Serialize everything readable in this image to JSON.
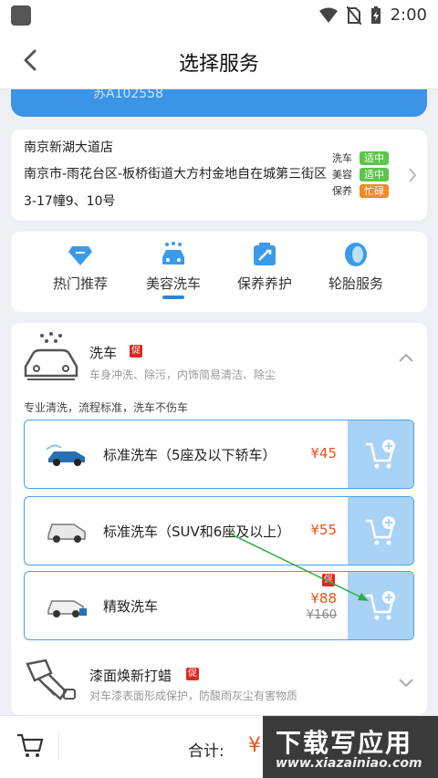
{
  "status_bar": {
    "time": "2:00"
  },
  "header": {
    "title": "选择服务"
  },
  "vehicle": {
    "plate": "苏A102558"
  },
  "store": {
    "name": "南京新湖大道店",
    "address": "南京市-雨花台区-板桥街道大方村金地自在城第三街区3-17幢9、10号",
    "statuses": [
      {
        "label": "洗车",
        "value": "适中",
        "color": "#5cc54a"
      },
      {
        "label": "美容",
        "value": "适中",
        "color": "#5cc54a"
      },
      {
        "label": "保养",
        "value": "忙碌",
        "color": "#f08a24"
      }
    ]
  },
  "categories": [
    {
      "label": "热门推荐",
      "icon": "diamond-icon"
    },
    {
      "label": "美容洗车",
      "icon": "car-wash-icon",
      "active": true
    },
    {
      "label": "保养养护",
      "icon": "maintenance-icon"
    },
    {
      "label": "轮胎服务",
      "icon": "tire-icon"
    }
  ],
  "service_wash": {
    "title": "洗车",
    "promo": "促",
    "subtitle": "车身冲洗、除污，内饰简易清洁、除尘",
    "note": "专业清洗，流程标准，洗车不伤车",
    "items": [
      {
        "name": "标准洗车（5座及以下轿车）",
        "price": "¥45"
      },
      {
        "name": "标准洗车（SUV和6座及以上）",
        "price": "¥55"
      },
      {
        "name": "精致洗车",
        "price": "¥88",
        "old_price": "¥160",
        "promo": "促"
      }
    ]
  },
  "service_paint": {
    "title": "漆面焕新打蜡",
    "promo": "促",
    "subtitle": "对车漆表面形成保护，防酸雨灰尘有害物质"
  },
  "bottom_bar": {
    "total_label": "合计:",
    "total_value": "¥"
  },
  "watermark": {
    "title": "下载写应用",
    "url": "www.xiazainiao.com"
  },
  "colors": {
    "accent": "#2b86e0",
    "price": "#e8531e",
    "cart_button": "#a9d3f6",
    "plate_card": "#3b94e6"
  }
}
